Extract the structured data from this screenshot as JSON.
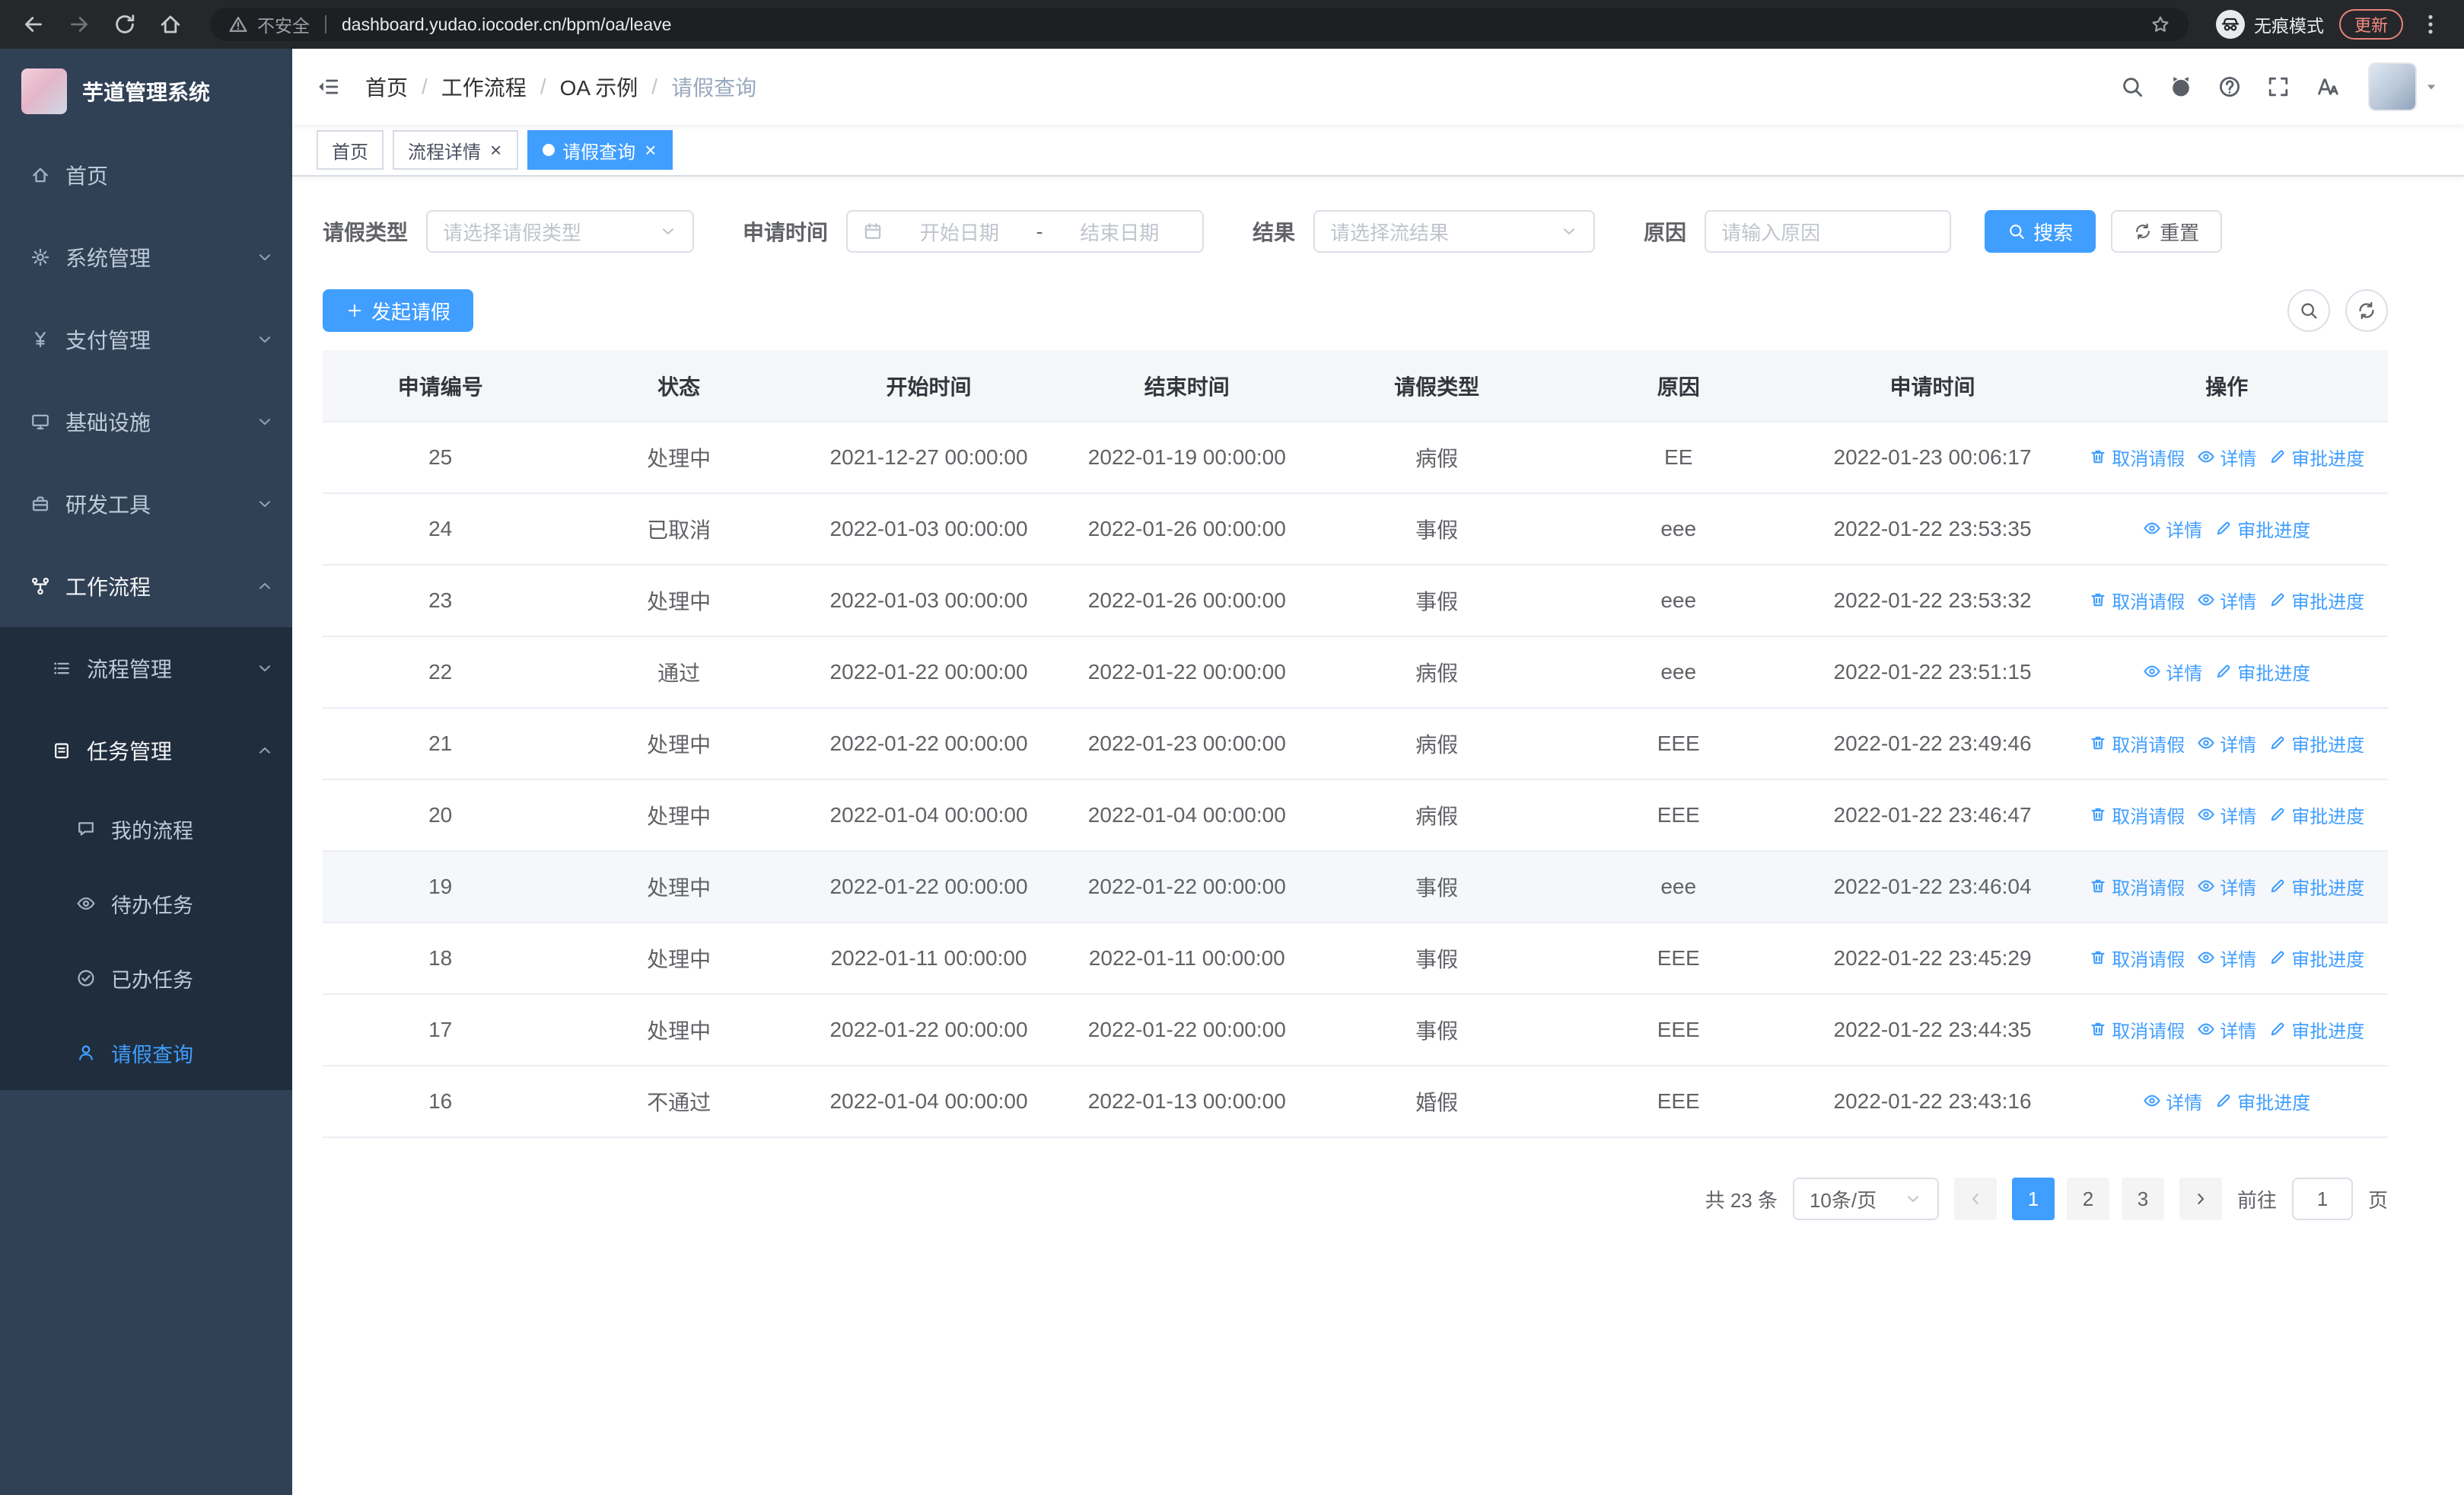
{
  "browser": {
    "security_warning": "不安全",
    "url": "dashboard.yudao.iocoder.cn/bpm/oa/leave",
    "incognito_label": "无痕模式",
    "update_label": "更新"
  },
  "app": {
    "title": "芋道管理系统"
  },
  "sidebar": {
    "menu": [
      {
        "key": "home",
        "label": "首页",
        "icon": "home",
        "level": 1
      },
      {
        "key": "system",
        "label": "系统管理",
        "icon": "gear",
        "level": 1,
        "chevron": "down"
      },
      {
        "key": "payment",
        "label": "支付管理",
        "icon": "yen",
        "level": 1,
        "chevron": "down"
      },
      {
        "key": "infra",
        "label": "基础设施",
        "icon": "monitor",
        "level": 1,
        "chevron": "down"
      },
      {
        "key": "devtools",
        "label": "研发工具",
        "icon": "toolbox",
        "level": 1,
        "chevron": "down"
      },
      {
        "key": "workflow",
        "label": "工作流程",
        "icon": "flow",
        "level": 1,
        "chevron": "up",
        "open": true
      },
      {
        "key": "process-mgmt",
        "label": "流程管理",
        "icon": "list",
        "level": 2,
        "chevron": "down"
      },
      {
        "key": "task-mgmt",
        "label": "任务管理",
        "icon": "clipboard",
        "level": 2,
        "chevron": "up",
        "open": true
      },
      {
        "key": "my-process",
        "label": "我的流程",
        "icon": "chat",
        "level": 3
      },
      {
        "key": "todo-tasks",
        "label": "待办任务",
        "icon": "eye",
        "level": 3
      },
      {
        "key": "done-tasks",
        "label": "已办任务",
        "icon": "check-circle",
        "level": 3
      },
      {
        "key": "leave-query",
        "label": "请假查询",
        "icon": "user",
        "level": 3,
        "active": true
      }
    ]
  },
  "header": {
    "breadcrumb": [
      "首页",
      "工作流程",
      "OA 示例",
      "请假查询"
    ],
    "right_icons": [
      "search",
      "github",
      "question",
      "fullscreen",
      "font-size"
    ]
  },
  "tabs": [
    {
      "key": "home",
      "label": "首页",
      "closable": false,
      "active": false
    },
    {
      "key": "process-detail",
      "label": "流程详情",
      "closable": true,
      "active": false
    },
    {
      "key": "leave-query",
      "label": "请假查询",
      "closable": true,
      "active": true
    }
  ],
  "filters": {
    "leave_type_label": "请假类型",
    "leave_type_placeholder": "请选择请假类型",
    "apply_time_label": "申请时间",
    "start_date_placeholder": "开始日期",
    "range_separator": "-",
    "end_date_placeholder": "结束日期",
    "result_label": "结果",
    "result_placeholder": "请选择流结果",
    "reason_label": "原因",
    "reason_placeholder": "请输入原因",
    "search_label": "搜索",
    "reset_label": "重置"
  },
  "toolbar": {
    "create_label": "发起请假"
  },
  "table": {
    "columns": [
      "申请编号",
      "状态",
      "开始时间",
      "结束时间",
      "请假类型",
      "原因",
      "申请时间",
      "操作"
    ],
    "action_labels": {
      "cancel": "取消请假",
      "detail": "详情",
      "progress": "审批进度"
    },
    "rows": [
      {
        "id": "25",
        "status": "处理中",
        "start": "2021-12-27 00:00:00",
        "end": "2022-01-19 00:00:00",
        "type": "病假",
        "reason": "EE",
        "applied": "2022-01-23 00:06:17",
        "cancelable": true,
        "hover": false
      },
      {
        "id": "24",
        "status": "已取消",
        "start": "2022-01-03 00:00:00",
        "end": "2022-01-26 00:00:00",
        "type": "事假",
        "reason": "eee",
        "applied": "2022-01-22 23:53:35",
        "cancelable": false,
        "hover": false
      },
      {
        "id": "23",
        "status": "处理中",
        "start": "2022-01-03 00:00:00",
        "end": "2022-01-26 00:00:00",
        "type": "事假",
        "reason": "eee",
        "applied": "2022-01-22 23:53:32",
        "cancelable": true,
        "hover": false
      },
      {
        "id": "22",
        "status": "通过",
        "start": "2022-01-22 00:00:00",
        "end": "2022-01-22 00:00:00",
        "type": "病假",
        "reason": "eee",
        "applied": "2022-01-22 23:51:15",
        "cancelable": false,
        "hover": false
      },
      {
        "id": "21",
        "status": "处理中",
        "start": "2022-01-22 00:00:00",
        "end": "2022-01-23 00:00:00",
        "type": "病假",
        "reason": "EEE",
        "applied": "2022-01-22 23:49:46",
        "cancelable": true,
        "hover": false
      },
      {
        "id": "20",
        "status": "处理中",
        "start": "2022-01-04 00:00:00",
        "end": "2022-01-04 00:00:00",
        "type": "病假",
        "reason": "EEE",
        "applied": "2022-01-22 23:46:47",
        "cancelable": true,
        "hover": false
      },
      {
        "id": "19",
        "status": "处理中",
        "start": "2022-01-22 00:00:00",
        "end": "2022-01-22 00:00:00",
        "type": "事假",
        "reason": "eee",
        "applied": "2022-01-22 23:46:04",
        "cancelable": true,
        "hover": true
      },
      {
        "id": "18",
        "status": "处理中",
        "start": "2022-01-11 00:00:00",
        "end": "2022-01-11 00:00:00",
        "type": "事假",
        "reason": "EEE",
        "applied": "2022-01-22 23:45:29",
        "cancelable": true,
        "hover": false
      },
      {
        "id": "17",
        "status": "处理中",
        "start": "2022-01-22 00:00:00",
        "end": "2022-01-22 00:00:00",
        "type": "事假",
        "reason": "EEE",
        "applied": "2022-01-22 23:44:35",
        "cancelable": true,
        "hover": false
      },
      {
        "id": "16",
        "status": "不通过",
        "start": "2022-01-04 00:00:00",
        "end": "2022-01-13 00:00:00",
        "type": "婚假",
        "reason": "EEE",
        "applied": "2022-01-22 23:43:16",
        "cancelable": false,
        "hover": false
      }
    ]
  },
  "pagination": {
    "total_text": "共 23 条",
    "page_size_text": "10条/页",
    "pages": [
      "1",
      "2",
      "3"
    ],
    "active_page": "1",
    "goto_label": "前往",
    "goto_value": "1",
    "unit_label": "页"
  },
  "colors": {
    "primary": "#409EFF",
    "sidebar_bg": "#304156",
    "submenu_bg": "#1F2D3D"
  }
}
